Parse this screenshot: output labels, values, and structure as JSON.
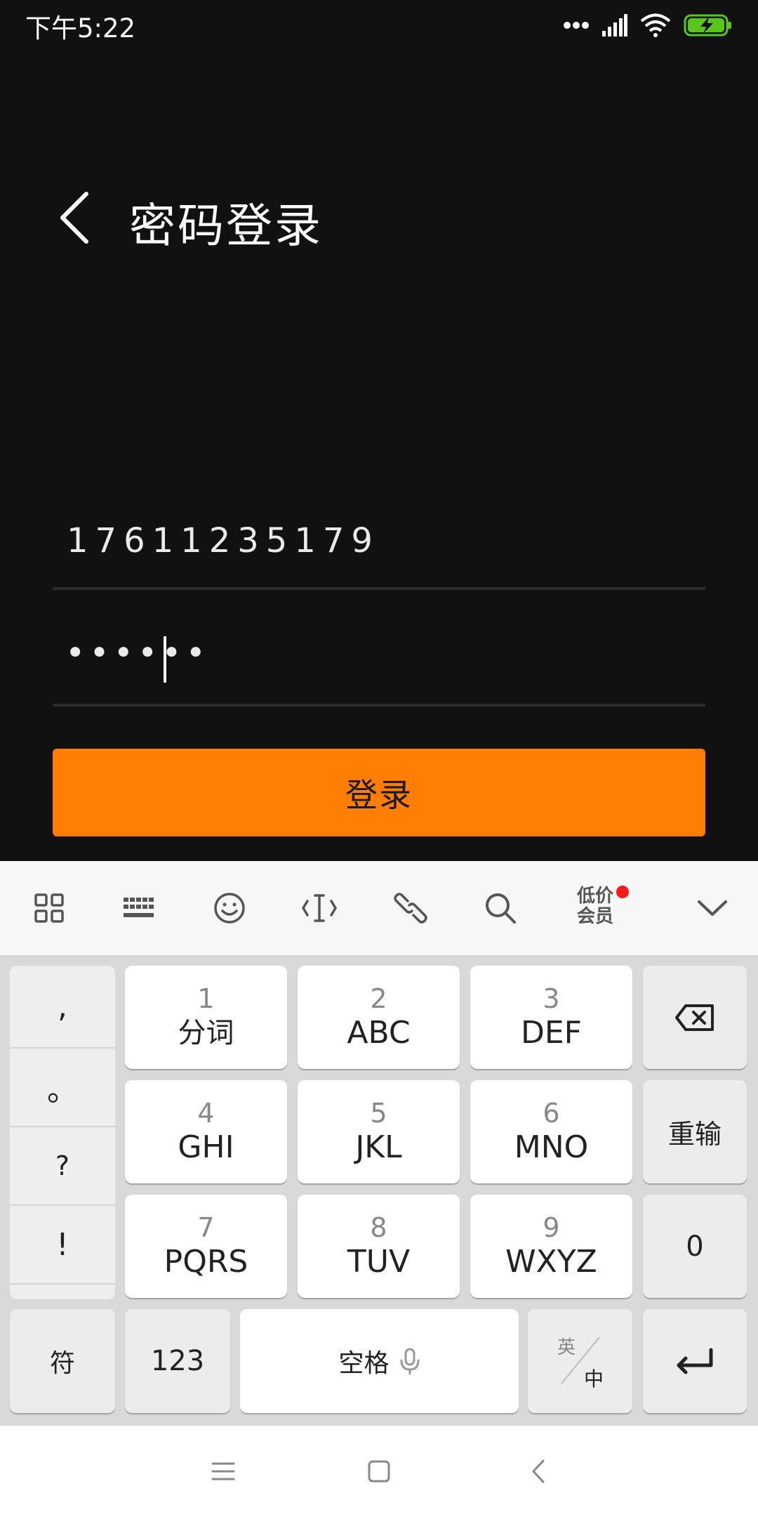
{
  "status_bar": {
    "time": "下午5:22",
    "battery_color": "#5ac51a"
  },
  "header": {
    "title": "密码登录",
    "back_icon": "chevron-left-icon"
  },
  "form": {
    "phone_value": "17611235179",
    "password_value": "••••••",
    "login_label": "登录",
    "login_color": "#ff7d03"
  },
  "keyboard_toolbar": {
    "icons": [
      "grid-icon",
      "keyboard-icon",
      "emoji-icon",
      "cursor-icon",
      "link-icon",
      "search-icon",
      "collapse-icon"
    ],
    "vip_line1": "低价",
    "vip_line2": "会员"
  },
  "keyboard": {
    "punctuation": [
      ",",
      "。",
      "?",
      "!"
    ],
    "keys": [
      {
        "num": "1",
        "letters": "分词"
      },
      {
        "num": "2",
        "letters": "ABC"
      },
      {
        "num": "3",
        "letters": "DEF"
      },
      {
        "num": "4",
        "letters": "GHI"
      },
      {
        "num": "5",
        "letters": "JKL"
      },
      {
        "num": "6",
        "letters": "MNO"
      },
      {
        "num": "7",
        "letters": "PQRS"
      },
      {
        "num": "8",
        "letters": "TUV"
      },
      {
        "num": "9",
        "letters": "WXYZ"
      }
    ],
    "reenter_label": "重输",
    "zero_label": "0",
    "symbols_label": "符",
    "numbers_label": "123",
    "space_label": "空格",
    "lang_en": "英",
    "lang_zh": "中"
  }
}
